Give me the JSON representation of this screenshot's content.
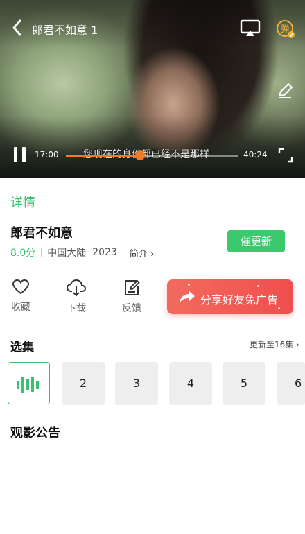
{
  "player": {
    "title": "郎君不如意 1",
    "current_time": "17:00",
    "total_time": "40:24",
    "progress": 0.43,
    "subtitle": "您现在的身份都已经不是那样",
    "danmaku_label": "弹",
    "colors": {
      "progress": "#f07a2a"
    }
  },
  "details": {
    "tab_label": "详情",
    "title": "郎君不如意",
    "score": "8.0分",
    "region": "中国大陆",
    "year": "2023",
    "intro_label": "简介 ›",
    "update_button": "催更新",
    "accent": "#3cc06f"
  },
  "actions": [
    {
      "label": "收藏",
      "icon": "heart-icon"
    },
    {
      "label": "下载",
      "icon": "download-cloud-icon"
    },
    {
      "label": "反馈",
      "icon": "feedback-edit-icon"
    }
  ],
  "share": {
    "label": "分享好友免广告",
    "icon": "share-arrow-icon"
  },
  "episodes": {
    "section_title": "选集",
    "update_status": "更新至16集 ›",
    "items": [
      "1",
      "2",
      "3",
      "4",
      "5",
      "6"
    ],
    "playing_index": 0
  },
  "notice": {
    "section_title": "观影公告"
  }
}
